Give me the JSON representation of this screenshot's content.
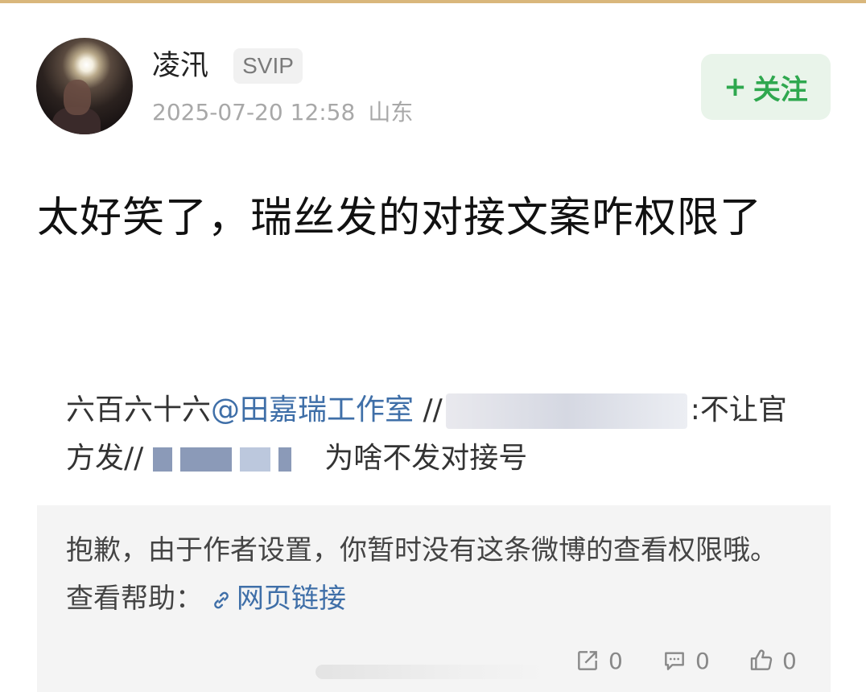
{
  "post": {
    "username": "凌汛",
    "badge": "SVIP",
    "date": "2025-07-20 12:58",
    "location": "山东",
    "follow_label": "关注",
    "text": "太好笑了，瑞丝发的对接文案咋权限了"
  },
  "quoted": {
    "prefix": "六百六十六",
    "mention": "@田嘉瑞工作室",
    "sep1": "//",
    "after_blur": ":不让官方发",
    "sep2": "//",
    "suffix": "为啥不发对接号"
  },
  "notice": {
    "text": "抱歉，由于作者设置，你暂时没有这条微博的查看权限哦。查看帮助：",
    "link_label": "网页链接"
  },
  "actions": {
    "share_count": "0",
    "comment_count": "0",
    "like_count": "0"
  },
  "colors": {
    "accent_green": "#2fa84f",
    "link_blue": "#3f6fa8",
    "top_strip": "#d9b77c"
  }
}
